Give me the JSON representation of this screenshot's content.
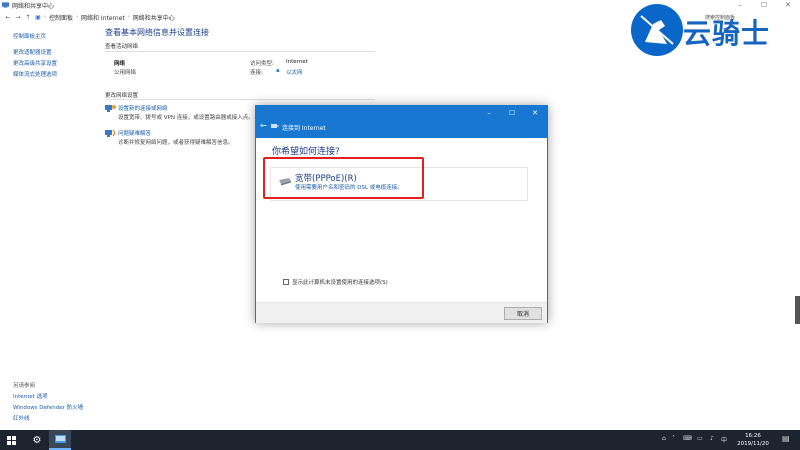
{
  "cp": {
    "title": "网络和共享中心",
    "breadcrumb": [
      "控制面板",
      "网络和 Internet",
      "网络和共享中心"
    ],
    "left": {
      "home": "控制面板主页",
      "links": [
        "更改适配器设置",
        "更改高级共享设置",
        "媒体流式处理选项"
      ],
      "see_also_title": "另请参阅",
      "see_also": [
        "Internet 选项",
        "Windows Defender 防火墙",
        "红外线"
      ]
    },
    "main": {
      "heading": "查看基本网络信息并设置连接",
      "active_title": "查看活动网络",
      "network_name": "网络",
      "network_type": "公用网络",
      "access_label": "访问类型:",
      "access_value": "Internet",
      "conn_label": "连接:",
      "conn_value": "以太网",
      "change_title": "更改网络设置",
      "setup_link": "设置新的连接或网络",
      "setup_desc": "设置宽带、拨号或 VPN 连接，或设置路由器或接入点。",
      "trouble_link": "问题疑难解答",
      "trouble_desc": "诊断并修复网络问题，或者获得疑难解答信息。"
    }
  },
  "watermark": {
    "text": "云骑士",
    "hint": "搜索控制面板"
  },
  "dialog": {
    "title": "连接到 Internet",
    "question": "你希望如何连接?",
    "option_title": "宽带(PPPoE)(R)",
    "option_desc": "使用需要用户名和密码的 DSL 或电缆连接。",
    "checkbox_label": "显示此计算机未设置使用的连接选项(S)",
    "cancel_label": "取消"
  },
  "taskbar": {
    "time": "16:26",
    "date": "2019/11/20"
  },
  "colors": {
    "dialog_accent": "#1777d1",
    "highlight_box": "#e02020",
    "link": "#1a5aa8",
    "taskbar": "#1c2430"
  }
}
